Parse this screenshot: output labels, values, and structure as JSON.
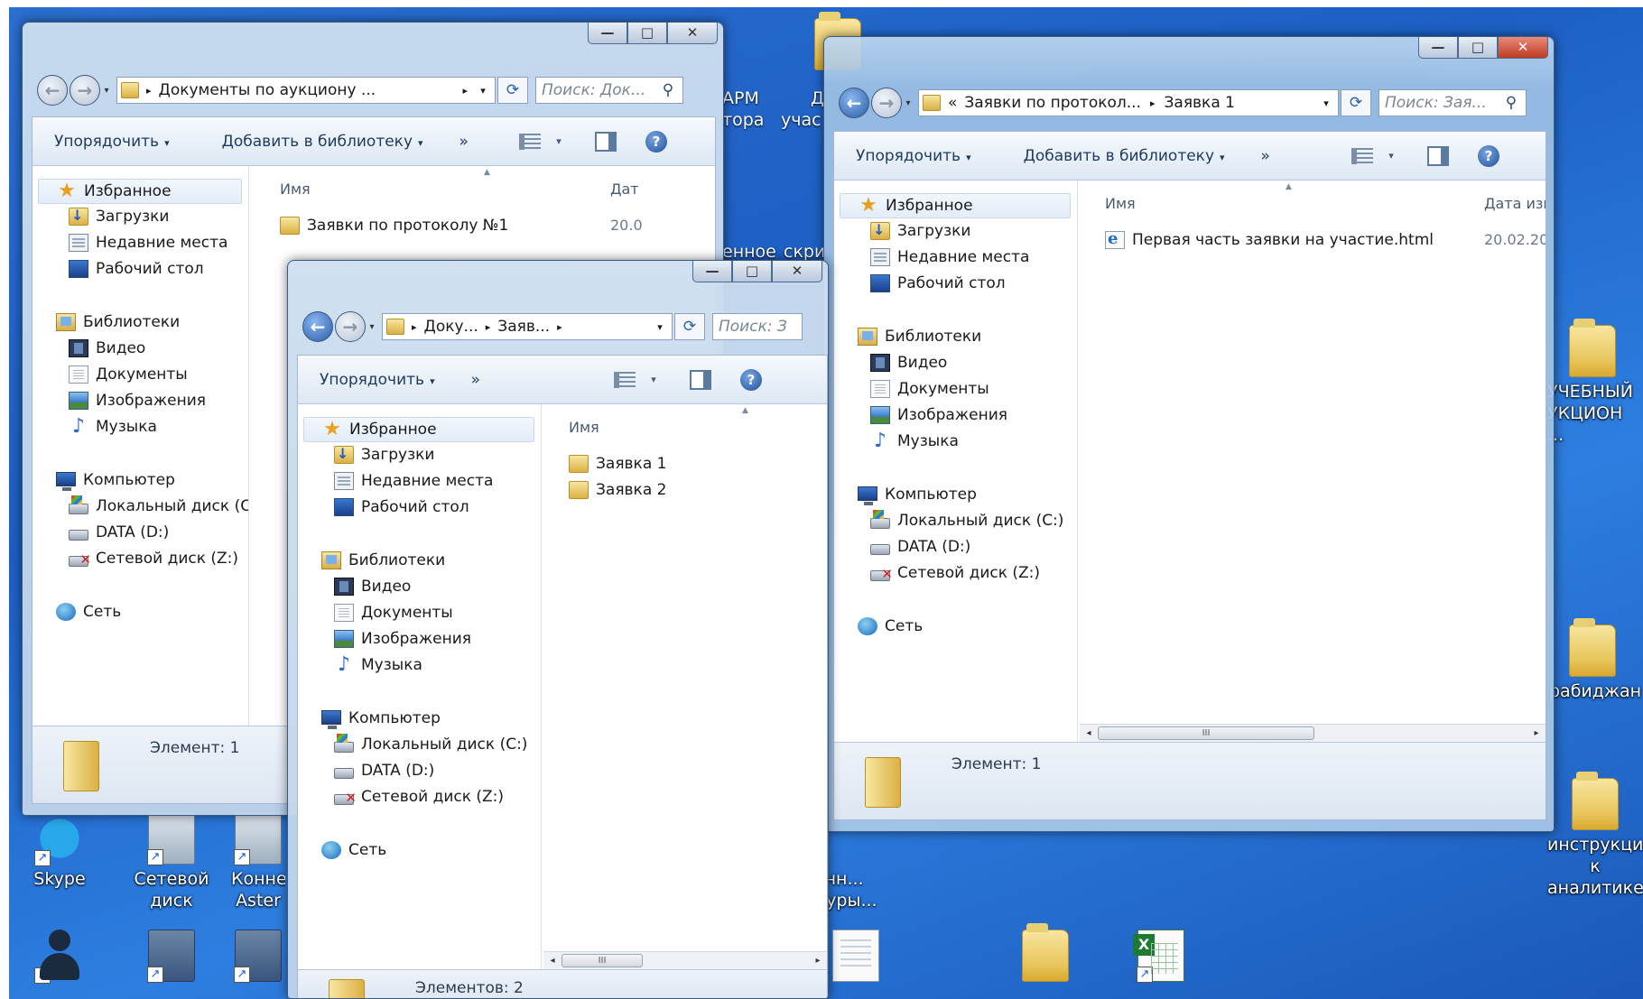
{
  "desktop": {
    "labels": {
      "arm": "АРМ",
      "tora": "тора",
      "d": "Д",
      "uchast": "учас",
      "ennoe": "енное",
      "skri": "скри",
      "uchebny": "УЧЕБНЫЙ\nУКЦИОН ...",
      "azerbaijan": "рабиджан",
      "instruction": "инструкция\nк аналитике",
      "skype": "Skype",
      "network_drive": "Сетевой\nдиск",
      "konne": "Конне\nAster",
      "onn": "онн...\nдуры..."
    }
  },
  "win1": {
    "address": "Документы по аукциону ...",
    "search_placeholder": "Поиск: Док...",
    "toolbar": {
      "organize": "Упорядочить",
      "add_to_library": "Добавить в библиотеку",
      "more": "»"
    },
    "col_name": "Имя",
    "col_date": "Дат",
    "files": [
      {
        "name": "Заявки по протоколу №1",
        "date": "20.0"
      }
    ],
    "status": "Элемент: 1"
  },
  "win2": {
    "address_part1": "Доку...",
    "address_part2": "Заяв...",
    "search_placeholder": "Поиск: З",
    "toolbar": {
      "organize": "Упорядочить",
      "more": "»"
    },
    "col_name": "Имя",
    "files": [
      {
        "name": "Заявка 1"
      },
      {
        "name": "Заявка 2"
      }
    ],
    "status": "Элементов: 2"
  },
  "win3": {
    "address_part1": "Заявки по протокол...",
    "address_part2": "Заявка 1",
    "search_placeholder": "Поиск: Зая...",
    "toolbar": {
      "organize": "Упорядочить",
      "add_to_library": "Добавить в библиотеку",
      "more": "»"
    },
    "col_name": "Имя",
    "col_date": "Дата изм",
    "files": [
      {
        "name": "Первая часть заявки на участие.html",
        "date": "20.02.20"
      }
    ],
    "status": "Элемент: 1"
  },
  "nav": {
    "favorites": "Избранное",
    "downloads": "Загрузки",
    "recent": "Недавние места",
    "desktop": "Рабочий стол",
    "libraries": "Библиотеки",
    "video": "Видео",
    "documents": "Документы",
    "images": "Изображения",
    "music": "Музыка",
    "computer": "Компьютер",
    "local_disk": "Локальный диск (C:)",
    "data_disk": "DATA (D:)",
    "net_disk": "Сетевой диск (Z:)",
    "network": "Сеть"
  },
  "glyphs": {
    "back": "←",
    "forward": "→",
    "breadcrumb_sep": "▸",
    "overflow": "«",
    "dropdown": "▾",
    "refresh": "⟳",
    "search": "⚲",
    "minimize": "—",
    "maximize": "□",
    "close": "✕",
    "help": "?",
    "scroll_left": "◂",
    "scroll_right": "▸",
    "scroll_thumb": "III",
    "sort_up": "▲",
    "star": "★",
    "note": "♪",
    "shortcut": "↗"
  }
}
